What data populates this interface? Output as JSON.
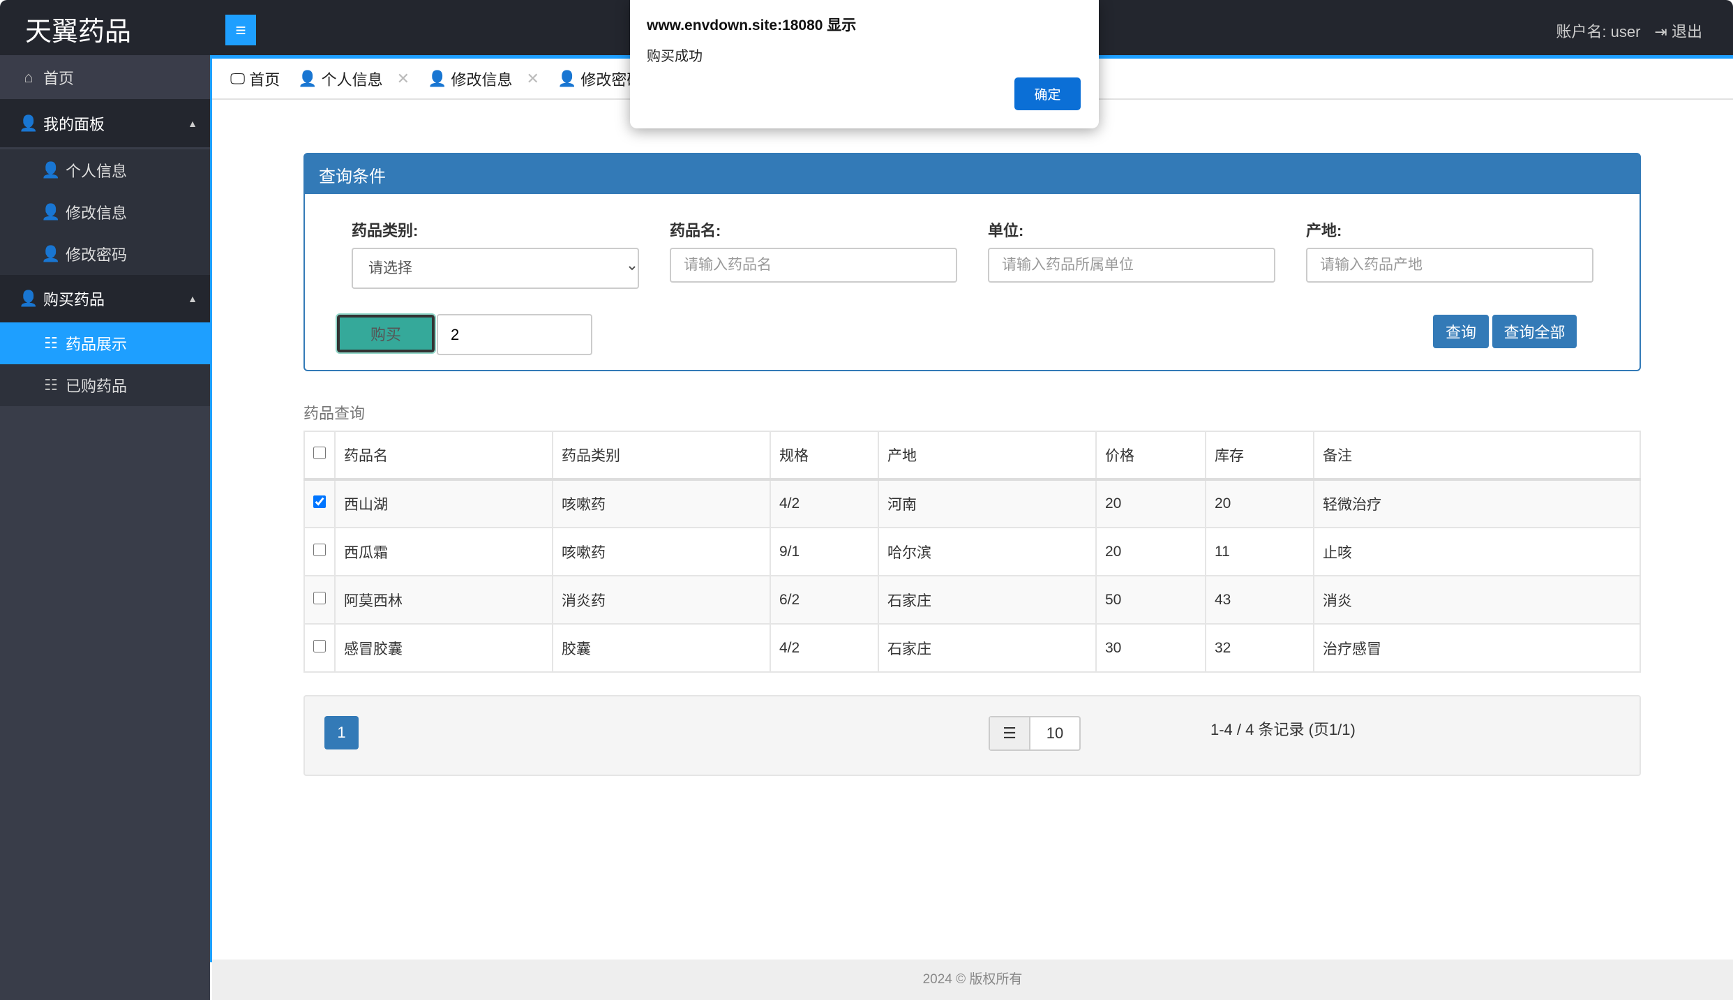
{
  "header": {
    "logo": "天翼药品",
    "menu_icon": "≡",
    "account_label": "账户名: ",
    "account_name": "user",
    "logout": "退出"
  },
  "sidebar": {
    "home": "首页",
    "panel": "我的面板",
    "personal": "个人信息",
    "edit_info": "修改信息",
    "edit_pwd": "修改密码",
    "buy": "购买药品",
    "display": "药品展示",
    "bought": "已购药品"
  },
  "tabs": [
    {
      "label": "首页"
    },
    {
      "label": "个人信息",
      "close": "✕"
    },
    {
      "label": "修改信息",
      "close": "✕"
    },
    {
      "label": "修改密码"
    }
  ],
  "query": {
    "title": "查询条件",
    "category_label": "药品类别:",
    "category_value": "请选择",
    "name_label": "药品名:",
    "name_placeholder": "请输入药品名",
    "unit_label": "单位:",
    "unit_placeholder": "请输入药品所属单位",
    "origin_label": "产地:",
    "origin_placeholder": "请输入药品产地",
    "buy_label": "购买",
    "qty_value": "2",
    "search_label": "查询",
    "search_all_label": "查询全部"
  },
  "table": {
    "section_label": "药品查询",
    "headers": [
      "药品名",
      "药品类别",
      "规格",
      "产地",
      "价格",
      "库存",
      "备注"
    ],
    "rows": [
      {
        "checked": true,
        "cells": [
          "西山湖",
          "咳嗽药",
          "4/2",
          "河南",
          "20",
          "20",
          "轻微治疗"
        ]
      },
      {
        "checked": false,
        "cells": [
          "西瓜霜",
          "咳嗽药",
          "9/1",
          "哈尔滨",
          "20",
          "11",
          "止咳"
        ]
      },
      {
        "checked": false,
        "cells": [
          "阿莫西林",
          "消炎药",
          "6/2",
          "石家庄",
          "50",
          "43",
          "消炎"
        ]
      },
      {
        "checked": false,
        "cells": [
          "感冒胶囊",
          "胶囊",
          "4/2",
          "石家庄",
          "30",
          "32",
          "治疗感冒"
        ]
      }
    ]
  },
  "pager": {
    "page": "1",
    "page_size": "10",
    "info": "1-4 / 4 条记录 (页1/1)"
  },
  "footer": "2024 © 版权所有",
  "dialog": {
    "title": "www.envdown.site:18080 显示",
    "message": "购买成功",
    "ok": "确定"
  }
}
